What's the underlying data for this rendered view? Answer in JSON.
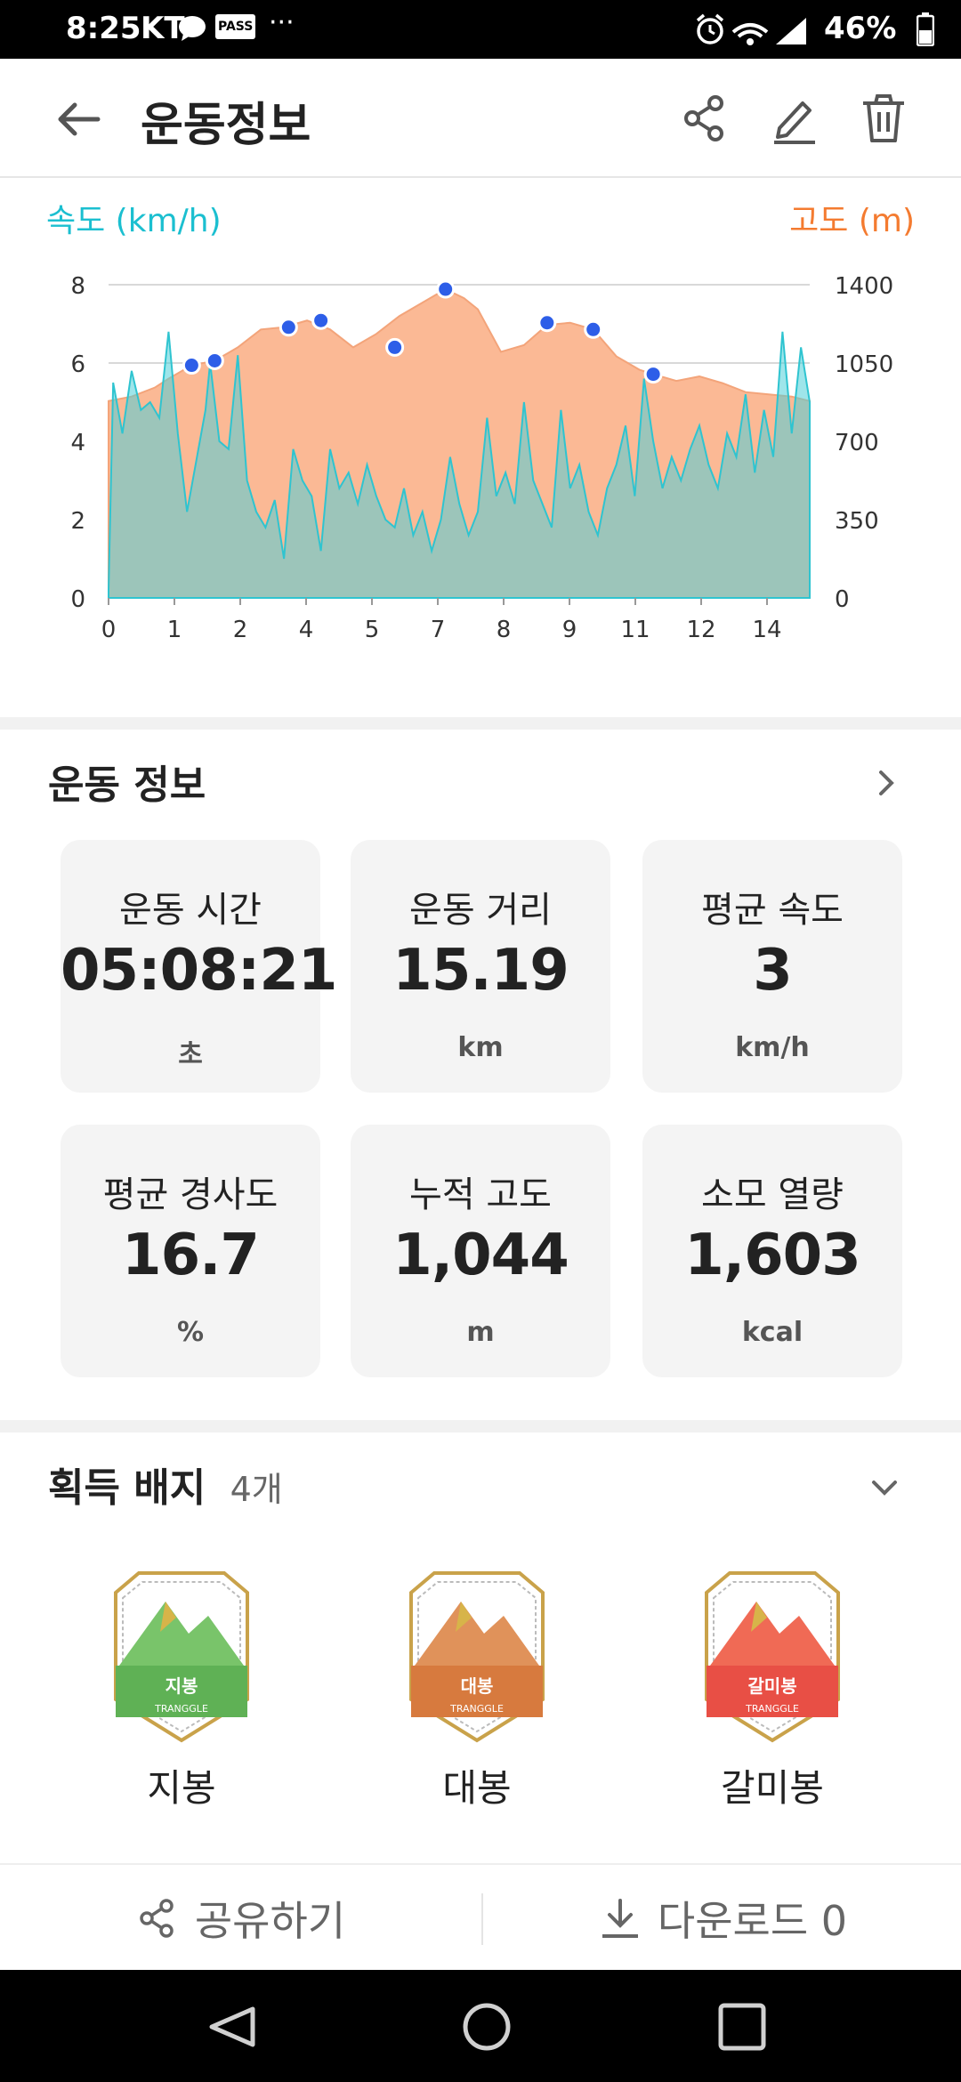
{
  "status_bar": {
    "time": "8:25",
    "carrier": "KT",
    "pass": "PASS",
    "more": "···",
    "battery": "46%"
  },
  "header": {
    "title": "운동정보",
    "icons": [
      "back-arrow-icon",
      "share-icon",
      "edit-icon",
      "delete-icon"
    ]
  },
  "chart_data": {
    "type": "area",
    "left_axis_label": "속도 (km/h)",
    "right_axis_label": "고도 (m)",
    "left_color": "#1bbfd0",
    "right_color": "#f47b30",
    "x_ticks": [
      "0",
      "1",
      "2",
      "4",
      "5",
      "7",
      "8",
      "9",
      "11",
      "12",
      "14"
    ],
    "y_left_ticks": [
      "8",
      "6",
      "4",
      "2",
      "0"
    ],
    "y_right_ticks": [
      "1400",
      "1050",
      "700",
      "350",
      "0"
    ],
    "ylim_left": [
      0,
      8
    ],
    "ylim_right": [
      0,
      1400
    ],
    "xlim": [
      0,
      15.19
    ],
    "grid": true,
    "series": [
      {
        "name": "속도 (km/h)",
        "x": [
          0,
          0.1,
          0.3,
          0.5,
          0.7,
          0.9,
          1.1,
          1.3,
          1.5,
          1.7,
          1.9,
          2.1,
          2.2,
          2.4,
          2.6,
          2.8,
          3.0,
          3.2,
          3.4,
          3.6,
          3.8,
          4.0,
          4.2,
          4.4,
          4.6,
          4.8,
          5.0,
          5.2,
          5.4,
          5.6,
          5.8,
          6.0,
          6.2,
          6.4,
          6.6,
          6.8,
          7.0,
          7.2,
          7.4,
          7.6,
          7.8,
          8.0,
          8.2,
          8.4,
          8.6,
          8.8,
          9.0,
          9.2,
          9.4,
          9.6,
          9.8,
          10.0,
          10.2,
          10.4,
          10.6,
          10.8,
          11.0,
          11.2,
          11.4,
          11.6,
          11.8,
          12.0,
          12.2,
          12.4,
          12.6,
          12.8,
          13.0,
          13.2,
          13.4,
          13.6,
          13.8,
          14.0,
          14.2,
          14.4,
          14.6,
          14.8,
          15.0,
          15.19
        ],
        "values": [
          0.2,
          5.5,
          4.2,
          5.8,
          4.8,
          5.0,
          4.6,
          6.8,
          4.2,
          2.2,
          3.5,
          4.8,
          6.0,
          4.0,
          3.8,
          6.2,
          3.0,
          2.2,
          1.8,
          2.5,
          1.0,
          3.8,
          3.0,
          2.6,
          1.2,
          3.8,
          2.8,
          3.2,
          2.4,
          3.4,
          2.6,
          2.0,
          1.8,
          2.8,
          1.6,
          2.2,
          1.2,
          2.0,
          3.6,
          2.4,
          1.6,
          2.2,
          4.6,
          2.6,
          3.2,
          2.4,
          5.0,
          3.0,
          2.4,
          1.8,
          4.8,
          2.8,
          3.4,
          2.2,
          1.6,
          2.8,
          3.4,
          4.4,
          2.6,
          5.6,
          4.0,
          2.8,
          3.6,
          3.0,
          3.8,
          4.4,
          3.4,
          2.8,
          4.2,
          3.6,
          5.2,
          3.2,
          4.8,
          3.6,
          6.8,
          4.2,
          6.4,
          5.0
        ]
      },
      {
        "name": "고도 (m)",
        "x": [
          0,
          0.5,
          1.0,
          1.3,
          1.8,
          2.3,
          2.8,
          3.3,
          3.8,
          4.3,
          4.8,
          5.3,
          5.8,
          6.3,
          6.8,
          7.3,
          7.7,
          8.0,
          8.5,
          9.0,
          9.5,
          10.0,
          10.5,
          11.0,
          11.5,
          11.8,
          12.3,
          12.8,
          13.3,
          13.8,
          14.3,
          14.8,
          15.19
        ],
        "values": [
          880,
          900,
          940,
          980,
          1040,
          1060,
          1120,
          1200,
          1210,
          1240,
          1200,
          1120,
          1180,
          1260,
          1320,
          1380,
          1340,
          1290,
          1100,
          1130,
          1220,
          1230,
          1200,
          1080,
          1020,
          1000,
          970,
          990,
          960,
          920,
          910,
          900,
          880
        ]
      }
    ],
    "waypoints": [
      {
        "x": 1.8,
        "y": 1040
      },
      {
        "x": 2.3,
        "y": 1060
      },
      {
        "x": 3.9,
        "y": 1210
      },
      {
        "x": 4.6,
        "y": 1240
      },
      {
        "x": 6.2,
        "y": 1120
      },
      {
        "x": 7.3,
        "y": 1380
      },
      {
        "x": 9.5,
        "y": 1230
      },
      {
        "x": 10.5,
        "y": 1200
      },
      {
        "x": 11.8,
        "y": 1000
      }
    ]
  },
  "info": {
    "title": "운동 정보",
    "cards": [
      {
        "label": "운동 시간",
        "value": "05:08:21",
        "unit": "초"
      },
      {
        "label": "운동 거리",
        "value": "15.19",
        "unit": "km"
      },
      {
        "label": "평균 속도",
        "value": "3",
        "unit": "km/h"
      },
      {
        "label": "평균 경사도",
        "value": "16.7",
        "unit": "%"
      },
      {
        "label": "누적 고도",
        "value": "1,044",
        "unit": "m"
      },
      {
        "label": "소모 열량",
        "value": "1,603",
        "unit": "kcal"
      }
    ]
  },
  "badges": {
    "title": "획득 배지",
    "count": "4개",
    "items": [
      {
        "name": "지봉",
        "inner_label": "지봉",
        "brand": "TRANGGLE",
        "color": "#79c46a",
        "banner": "#5fb155"
      },
      {
        "name": "대봉",
        "inner_label": "대봉",
        "brand": "TRANGGLE",
        "color": "#e0925a",
        "banner": "#d77a3e"
      },
      {
        "name": "갈미봉",
        "inner_label": "갈미봉",
        "brand": "TRANGGLE",
        "color": "#f06a55",
        "banner": "#e84f45"
      }
    ]
  },
  "actions": {
    "share_label": "공유하기",
    "download_label": "다운로드 0"
  }
}
